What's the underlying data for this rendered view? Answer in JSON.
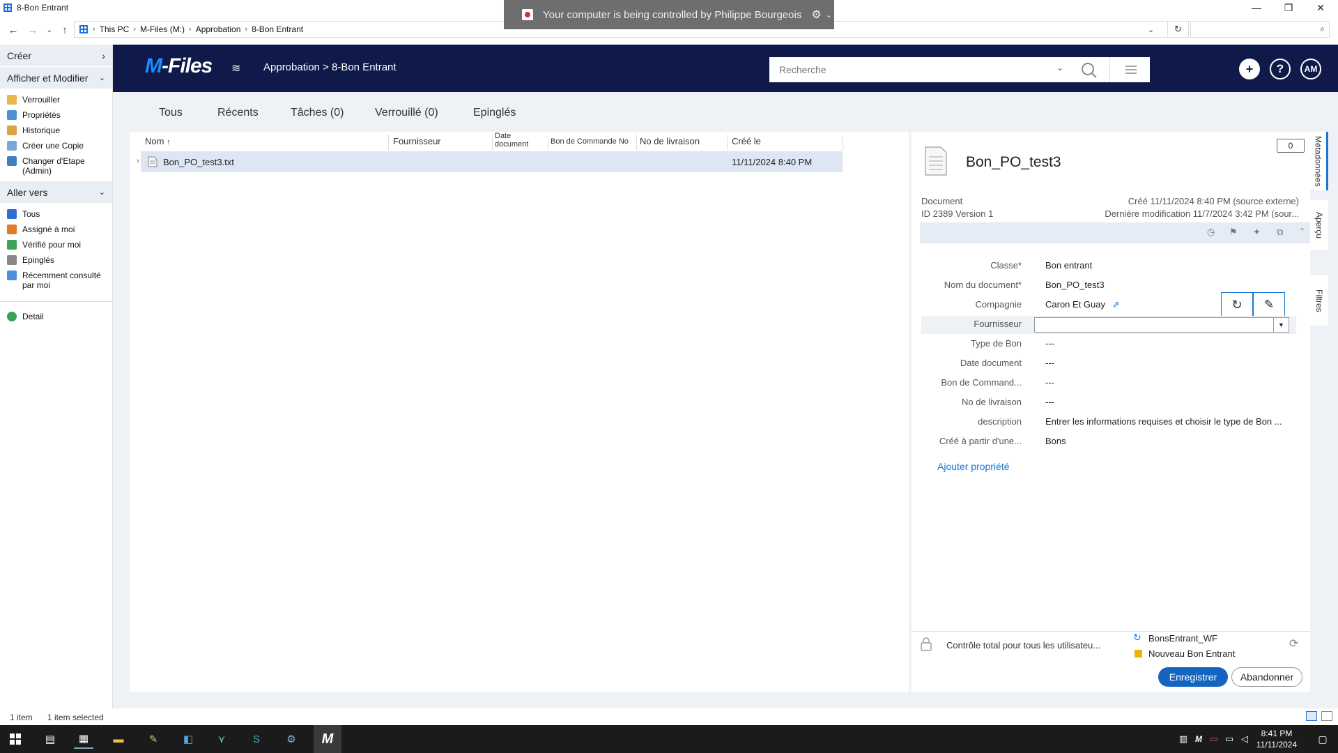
{
  "window": {
    "title": "8-Bon Entrant",
    "minimize": "—",
    "maximize": "❐",
    "close": "✕"
  },
  "remote_banner": {
    "text": "Your computer is being controlled by Philippe Bourgeois"
  },
  "address": {
    "crumbs": [
      "This PC",
      "M-Files (M:)",
      "Approbation",
      "8-Bon Entrant"
    ]
  },
  "left_pane": {
    "creer": "Créer",
    "afficher": "Afficher et Modifier",
    "afficher_items": [
      "Verrouiller",
      "Propriétés",
      "Historique",
      "Créer une Copie",
      "Changer d'Etape (Admin)"
    ],
    "aller_vers": "Aller vers",
    "aller_items": [
      "Tous",
      "Assigné à moi",
      "Vérifié pour moi",
      "Epinglés",
      "Récemment consulté par moi"
    ],
    "detail": "Detail"
  },
  "mf_header": {
    "logo_m": "M",
    "logo_rest": "-Files",
    "path": "Approbation > 8-Bon Entrant",
    "search_placeholder": "Recherche",
    "avatar": "AM"
  },
  "tabs": [
    "Tous",
    "Récents",
    "Tâches (0)",
    "Verrouillé (0)",
    "Epinglés"
  ],
  "list": {
    "columns": [
      "Nom",
      "Fournisseur",
      "Date document",
      "Bon de Commande No",
      "No de livraison",
      "Créé le"
    ],
    "rows": [
      {
        "name": "Bon_PO_test3.txt",
        "created": "11/11/2024 8:40 PM"
      }
    ]
  },
  "meta": {
    "title": "Bon_PO_test3",
    "comment_count": "0",
    "type": "Document",
    "id_version": "ID 2389  Version 1",
    "created": "Créé 11/11/2024 8:40 PM (source externe)",
    "modified": "Dernière modification 11/7/2024 3:42 PM (sour...",
    "props": [
      {
        "label": "Classe*",
        "value": "Bon entrant"
      },
      {
        "label": "Nom du document*",
        "value": "Bon_PO_test3"
      },
      {
        "label": "Compagnie",
        "value": "Caron Et Guay"
      },
      {
        "label": "Fournisseur",
        "value": ""
      },
      {
        "label": "Type de Bon",
        "value": "---"
      },
      {
        "label": "Date document",
        "value": "---"
      },
      {
        "label": "Bon de Command...",
        "value": "---"
      },
      {
        "label": "No de livraison",
        "value": "---"
      },
      {
        "label": "description",
        "value": "Entrer les informations requises et choisir le type de Bon ..."
      },
      {
        "label": "Créé à partir d'une...",
        "value": "Bons"
      }
    ],
    "add_property": "Ajouter propriété",
    "permissions": "Contrôle total pour tous les utilisateu...",
    "workflow": "BonsEntrant_WF",
    "state": "Nouveau Bon Entrant",
    "save": "Enregistrer",
    "cancel": "Abandonner"
  },
  "rail": {
    "metadata": "Métadonnées",
    "preview": "Aperçu",
    "filters": "Filtres"
  },
  "status": {
    "count": "1 item",
    "selected": "1 item selected"
  },
  "taskbar": {
    "time": "8:41 PM",
    "date": "11/11/2024"
  },
  "colors": {
    "header": "#0f1a4a",
    "accent": "#1565c0",
    "workflow_state": "#e6b800"
  }
}
